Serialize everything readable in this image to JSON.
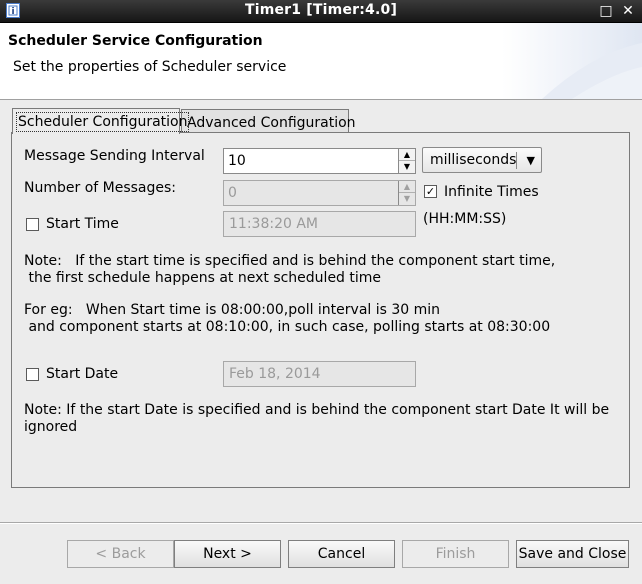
{
  "window": {
    "title": "Timer1 [Timer:4.0]",
    "minimize_glyph": "□",
    "close_glyph": "✕"
  },
  "header": {
    "title": "Scheduler Service Configuration",
    "subtitle": "Set the properties of Scheduler service"
  },
  "tabs": [
    {
      "label": "Scheduler Configuration",
      "active": true
    },
    {
      "label": "Advanced Configuration",
      "active": false
    }
  ],
  "form": {
    "interval_label": "Message Sending Interval",
    "interval_value": "10",
    "interval_unit": "milliseconds",
    "messages_label": "Number of Messages:",
    "messages_value": "0",
    "infinite_label": "Infinite Times",
    "infinite_checked": true,
    "start_time_label": "Start Time",
    "start_time_checked": false,
    "start_time_value": "11:38:20 AM",
    "time_format": "(HH:MM:SS)",
    "note1_line1": "Note:   If the start time is specified and is behind the component start time,",
    "note1_line2": " the first schedule happens at next scheduled time",
    "example_line1": "For eg:   When Start time is 08:00:00,poll interval is 30 min",
    "example_line2": " and component starts at 08:10:00, in such case, polling starts at 08:30:00",
    "start_date_label": "Start Date",
    "start_date_checked": false,
    "start_date_value": "Feb 18, 2014",
    "note2_line1": "Note: If the start Date is specified and is behind the component start Date It will be",
    "note2_line2": "ignored"
  },
  "buttons": {
    "back": "< Back",
    "next": "Next >",
    "cancel": "Cancel",
    "finish": "Finish",
    "save_close": "Save and Close"
  },
  "glyphs": {
    "check": "✓",
    "spin_up": "▲",
    "spin_down": "▼",
    "combo_arrow": "▼"
  },
  "icons": [
    "app-icon",
    "minimize-icon",
    "close-icon",
    "spin-up-icon",
    "spin-down-icon",
    "dropdown-arrow-icon"
  ]
}
